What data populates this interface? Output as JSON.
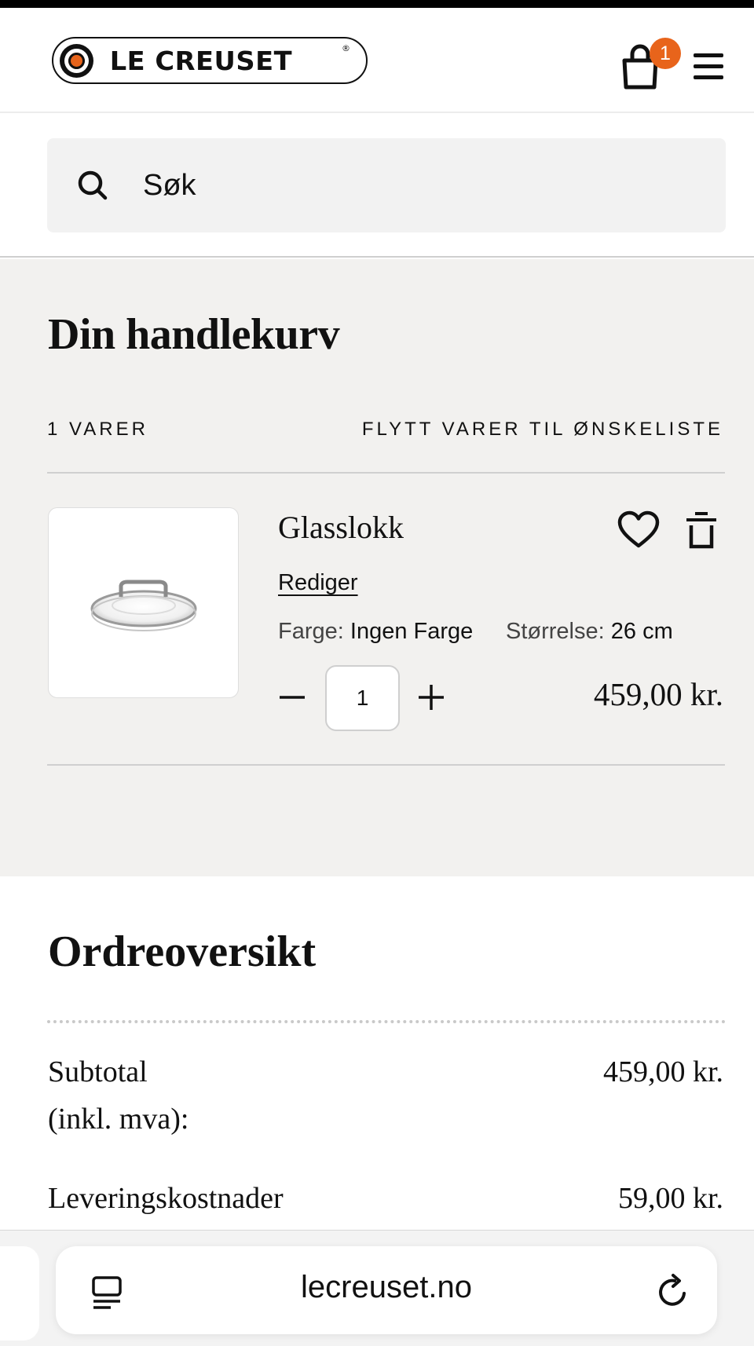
{
  "header": {
    "logo_text": "LE CREUSET",
    "logo_reg": "®",
    "cart_count": "1",
    "brand_accent": "#e8641b"
  },
  "search": {
    "placeholder": "Søk"
  },
  "cart": {
    "title": "Din handlekurv",
    "item_count": "1 VARER",
    "move_to_wishlist": "FLYTT VARER TIL ØNSKELISTE",
    "items": [
      {
        "name": "Glasslokk",
        "edit_label": "Rediger",
        "color_key": "Farge:",
        "color_value": "Ingen Farge",
        "size_key": "Størrelse:",
        "size_value": "26 cm",
        "quantity": "1",
        "price": "459,00 kr."
      }
    ]
  },
  "order": {
    "title": "Ordreoversikt",
    "subtotal_label_1": "Subtotal",
    "subtotal_label_2": "(inkl. mva):",
    "subtotal_value": "459,00 kr.",
    "shipping_label": "Leveringskostnader",
    "shipping_value": "59,00 kr."
  },
  "browser": {
    "url": "lecreuset.no"
  },
  "icons": [
    "shopping-bag-icon",
    "menu-icon",
    "search-icon",
    "heart-icon",
    "trash-icon",
    "minus-icon",
    "plus-icon",
    "reader-icon",
    "reload-icon"
  ]
}
